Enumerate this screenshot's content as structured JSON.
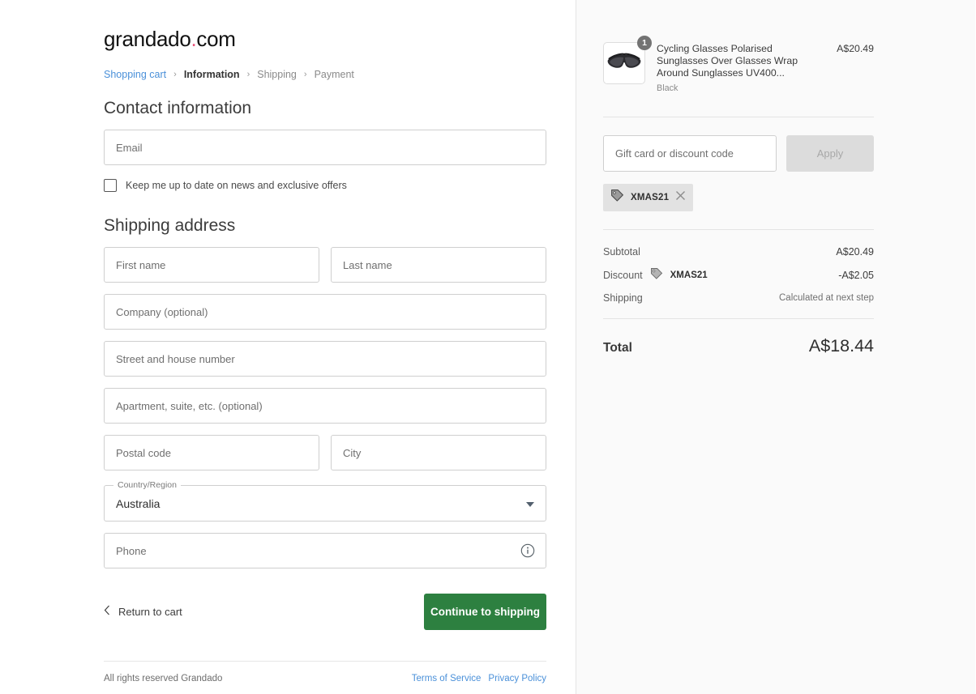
{
  "brand": {
    "name": "grandado",
    "dot": ".",
    "tld": "com"
  },
  "breadcrumb": {
    "items": [
      {
        "label": "Shopping cart",
        "state": "link"
      },
      {
        "label": "Information",
        "state": "current"
      },
      {
        "label": "Shipping",
        "state": "muted"
      },
      {
        "label": "Payment",
        "state": "muted"
      }
    ],
    "separator": "›"
  },
  "contact": {
    "heading": "Contact information",
    "email_placeholder": "Email",
    "email_value": "",
    "newsletter_label": "Keep me up to date on news and exclusive offers",
    "newsletter_checked": false
  },
  "shipping": {
    "heading": "Shipping address",
    "first_name_placeholder": "First name",
    "last_name_placeholder": "Last name",
    "company_placeholder": "Company (optional)",
    "street_placeholder": "Street and house number",
    "apartment_placeholder": "Apartment, suite, etc. (optional)",
    "postal_placeholder": "Postal code",
    "city_placeholder": "City",
    "country_label": "Country/Region",
    "country_value": "Australia",
    "phone_placeholder": "Phone",
    "phone_info_icon": "info-circle-icon"
  },
  "actions": {
    "return_label": "Return to cart",
    "return_icon": "chevron-left-icon",
    "continue_label": "Continue to shipping",
    "continue_color": "#2d8040"
  },
  "footer": {
    "copyright": "All rights reserved Grandado",
    "links": [
      {
        "label": "Terms of Service"
      },
      {
        "label": "Privacy Policy"
      }
    ],
    "link_color": "#4a90d9"
  },
  "summary": {
    "item": {
      "image_alt": "black-wrap-around-sunglasses",
      "quantity": "1",
      "title": "Cycling Glasses Polarised Sunglasses Over Glasses Wrap Around Sunglasses UV400...",
      "variant": "Black",
      "price": "A$20.49"
    },
    "discount": {
      "input_placeholder": "Gift card or discount code",
      "input_value": "",
      "apply_label": "Apply",
      "apply_disabled": true,
      "chip_icon": "tag-icon",
      "chip_code": "XMAS21",
      "chip_remove_icon": "close-icon"
    },
    "rows": [
      {
        "label": "Subtotal",
        "code": "",
        "value": "A$20.49",
        "muted": false
      },
      {
        "label": "Discount",
        "code": "XMAS21",
        "value": "-A$2.05",
        "muted": false
      },
      {
        "label": "Shipping",
        "code": "",
        "value": "Calculated at next step",
        "muted": true
      }
    ],
    "total_label": "Total",
    "total_value": "A$18.44"
  }
}
